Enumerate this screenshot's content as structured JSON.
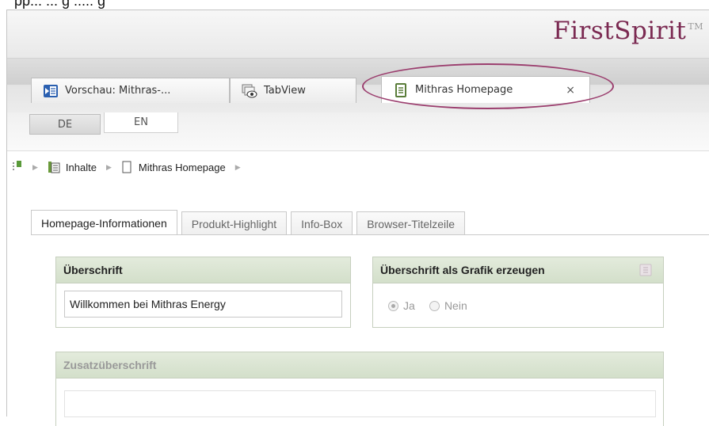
{
  "caption": "pp... ... g  ..... g",
  "header": {
    "logo": "FirstSpirit",
    "trademark": "TM",
    "logo_color": "#7b2a52"
  },
  "window_tabs": [
    {
      "label": "Vorschau: Mithras-...",
      "icon": "preview-icon"
    },
    {
      "label": "TabView",
      "icon": "tabview-icon"
    },
    {
      "label": "Mithras Homepage",
      "icon": "page-icon",
      "close": "×"
    }
  ],
  "languages": {
    "de": "DE",
    "en": "EN"
  },
  "breadcrumb": {
    "items": [
      "Inhalte",
      "Mithras Homepage"
    ]
  },
  "form_tabs": [
    "Homepage-Informationen",
    "Produkt-Highlight",
    "Info-Box",
    "Browser-Titelzeile"
  ],
  "fields": {
    "headline": {
      "label": "Überschrift",
      "value": "Willkommen bei Mithras Energy"
    },
    "graphic": {
      "label": "Überschrift als Grafik erzeugen",
      "options": [
        "Ja",
        "Nein"
      ],
      "selected": "Ja"
    },
    "subheadline": {
      "label": "Zusatzüberschrift",
      "value": ""
    }
  },
  "colors": {
    "highlight_ellipse": "#9b3e6e",
    "field_header": "#d9e4d1"
  }
}
